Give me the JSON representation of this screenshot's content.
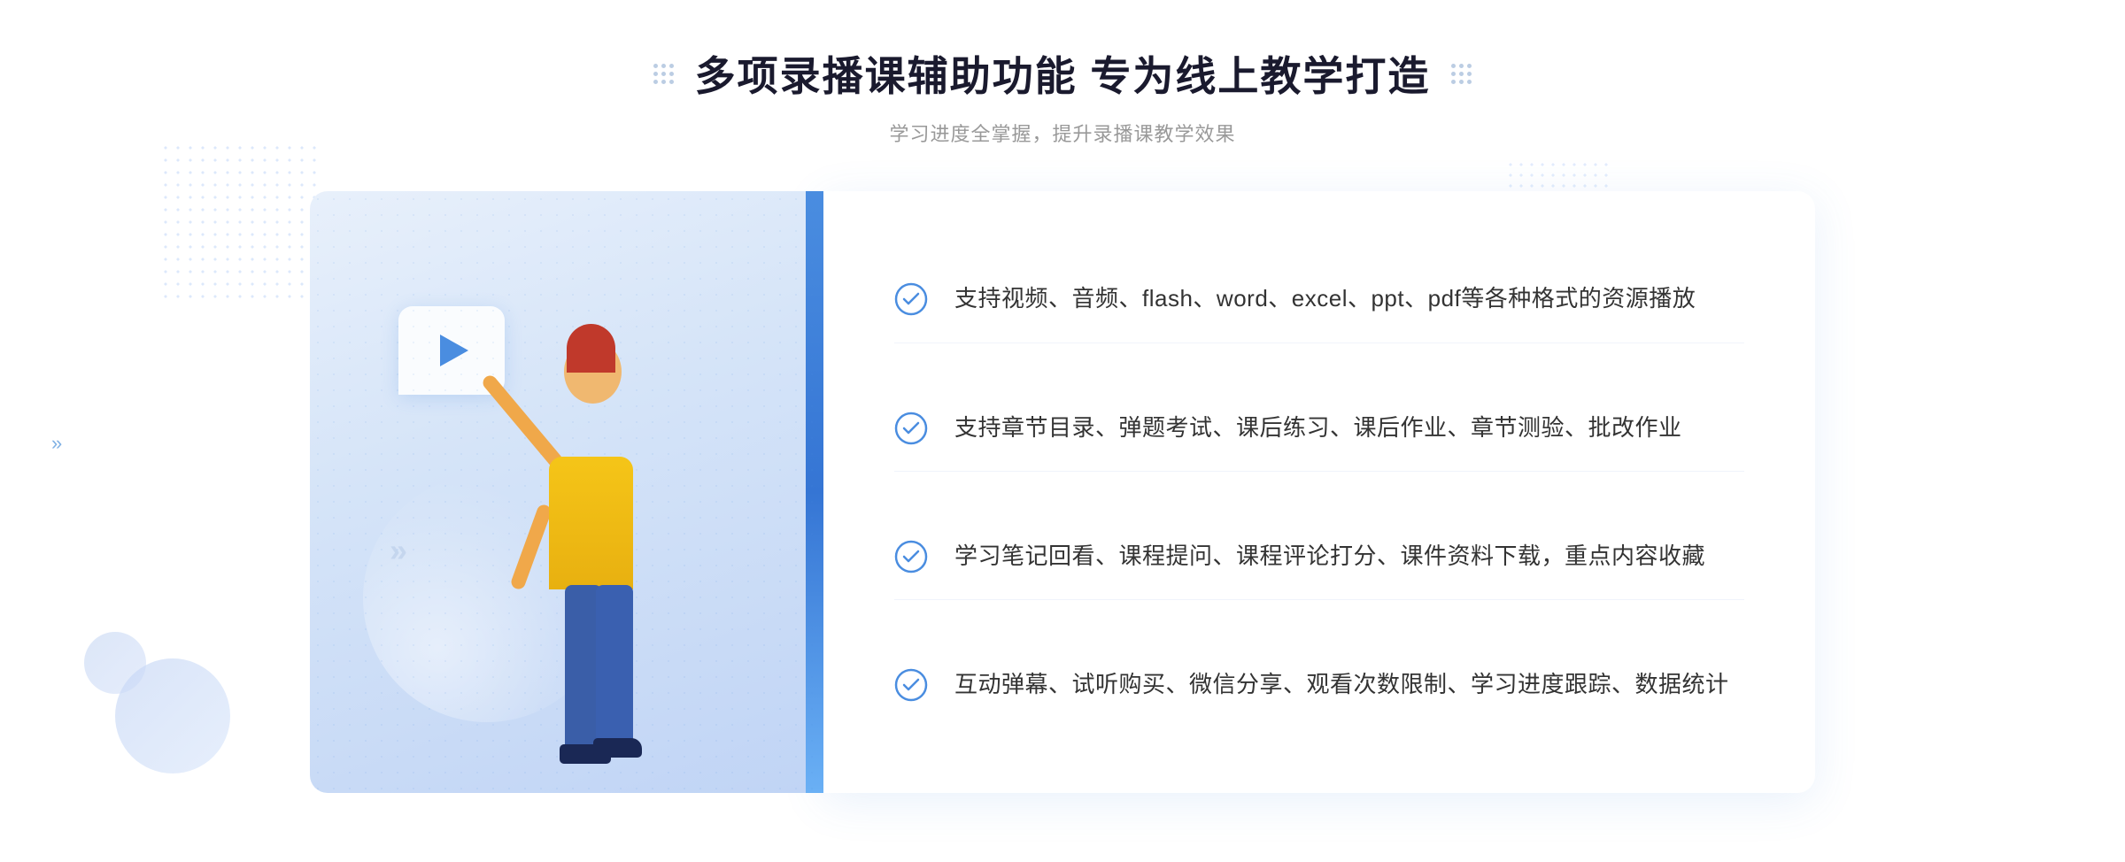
{
  "header": {
    "title": "多项录播课辅助功能 专为线上教学打造",
    "subtitle": "学习进度全掌握，提升录播课教学效果"
  },
  "features": [
    {
      "id": "feature-1",
      "text": "支持视频、音频、flash、word、excel、ppt、pdf等各种格式的资源播放"
    },
    {
      "id": "feature-2",
      "text": "支持章节目录、弹题考试、课后练习、课后作业、章节测验、批改作业"
    },
    {
      "id": "feature-3",
      "text": "学习笔记回看、课程提问、课程评论打分、课件资料下载，重点内容收藏"
    },
    {
      "id": "feature-4",
      "text": "互动弹幕、试听购买、微信分享、观看次数限制、学习进度跟踪、数据统计"
    }
  ],
  "colors": {
    "primary": "#4a8de0",
    "title": "#1a1a2e",
    "subtitle": "#999999",
    "text": "#333333",
    "check": "#4a8de0"
  }
}
